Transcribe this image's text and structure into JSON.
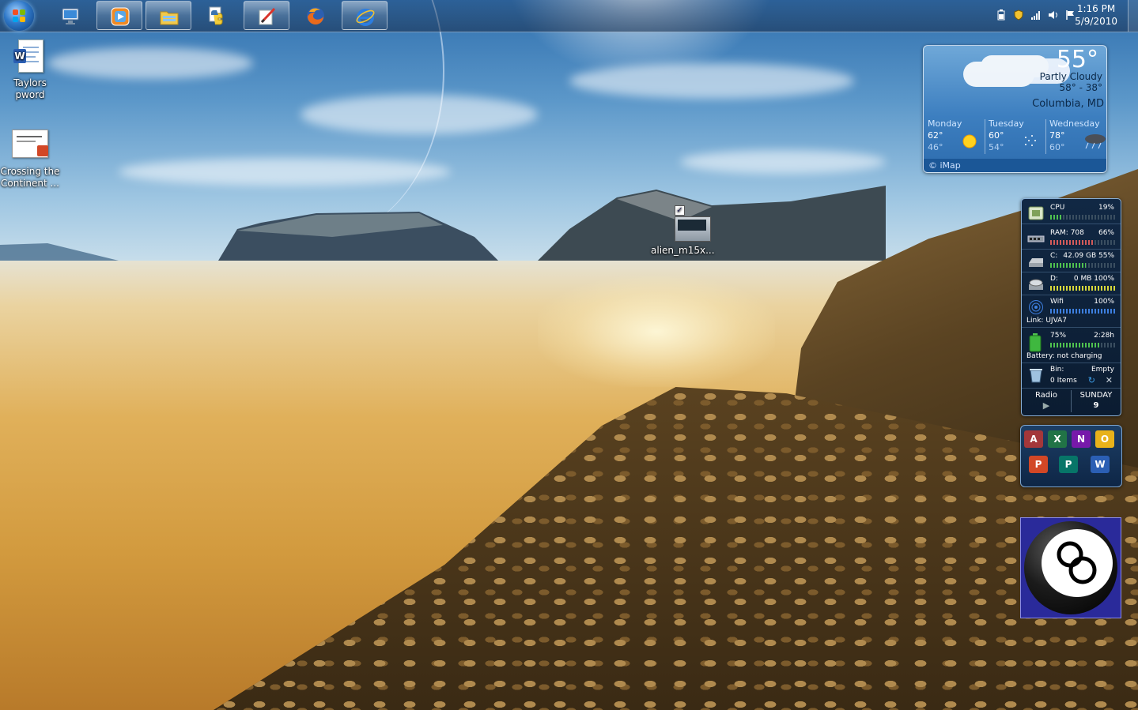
{
  "taskbar": {
    "buttons": [
      {
        "name": "start"
      },
      {
        "name": "remote-desktop"
      },
      {
        "name": "media-player"
      },
      {
        "name": "windows-explorer"
      },
      {
        "name": "python"
      },
      {
        "name": "paint"
      },
      {
        "name": "firefox"
      },
      {
        "name": "internet-explorer"
      }
    ],
    "clock": {
      "time": "1:16 PM",
      "date": "5/9/2010"
    }
  },
  "desktop": {
    "icons": [
      {
        "label": "Taylors pword",
        "icon": "word-document-icon"
      },
      {
        "label": "Crossing the Continent ...",
        "icon": "powerpoint-presentation-icon"
      },
      {
        "label": "alien_m15x...",
        "icon": "laptop-image-icon"
      }
    ]
  },
  "weather": {
    "temp": "55°",
    "condition": "Partly Cloudy",
    "range": "58°  -  38°",
    "city": "Columbia, MD",
    "forecast": [
      {
        "day": "Monday",
        "hi": "62°",
        "lo": "46°",
        "icon": "sunny-icon"
      },
      {
        "day": "Tuesday",
        "hi": "60°",
        "lo": "54°",
        "icon": "snow-flurries-icon"
      },
      {
        "day": "Wednesday",
        "hi": "78°",
        "lo": "60°",
        "icon": "thunderstorm-icon"
      }
    ],
    "source": "© iMap"
  },
  "sysmon": {
    "cpu": {
      "label": "CPU",
      "value": "19%",
      "level": 0.19
    },
    "ram": {
      "label": "RAM: 708",
      "value": "66%",
      "level": 0.66
    },
    "c": {
      "label": "C:",
      "value": "42.09 GB 55%",
      "level": 0.55
    },
    "d": {
      "label": "D:",
      "value": "0 MB 100%",
      "level": 1.0
    },
    "wifi": {
      "label": "Wifi",
      "value": "100%",
      "link": "Link: UJVA7",
      "level": 1.0
    },
    "battery": {
      "label": "75%",
      "value": "2:28h",
      "status": "Battery: not charging",
      "level": 0.75
    },
    "bin": {
      "label": "Bin:",
      "value": "Empty",
      "items": "0 Items"
    },
    "radio": "Radio",
    "day": "SUNDAY",
    "date": "9"
  },
  "launcher": {
    "apps": [
      "access",
      "excel",
      "onenote",
      "outlook",
      "powerpoint",
      "publisher",
      "word"
    ]
  },
  "colors": {
    "accent": "#2f78c8",
    "cpu_bar": "#4fc24f",
    "ram_bar": "#d45a5a",
    "disk_bar": "#4fc24f",
    "d_bar": "#d7d83a",
    "wifi_bar": "#3d7fe0",
    "battery_bar": "#4fc24f"
  }
}
